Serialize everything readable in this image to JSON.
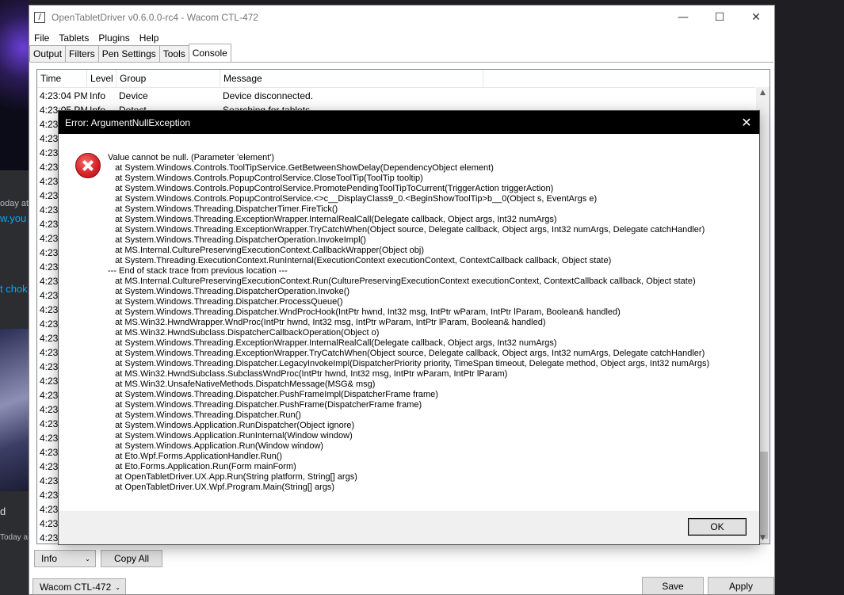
{
  "background": {
    "snippets": [
      "oday at",
      "w.you",
      "t chok",
      "d",
      "Today a"
    ]
  },
  "window": {
    "title": "OpenTabletDriver v0.6.0.0-rc4 - Wacom CTL-472",
    "app_icon": "/",
    "minimize_glyph": "—",
    "maximize_glyph": "☐",
    "close_glyph": "✕"
  },
  "menu": [
    "File",
    "Tablets",
    "Plugins",
    "Help"
  ],
  "tabs": [
    {
      "label": "Output",
      "active": false
    },
    {
      "label": "Filters",
      "active": false
    },
    {
      "label": "Pen Settings",
      "active": false
    },
    {
      "label": "Tools",
      "active": false
    },
    {
      "label": "Console",
      "active": true
    }
  ],
  "console": {
    "columns": [
      "Time",
      "Level",
      "Group",
      "Message"
    ],
    "rows": [
      {
        "time": "4:23:04 PM",
        "level": "Info",
        "group": "Device",
        "message": "Device disconnected."
      },
      {
        "time": "4:23:05 PM",
        "level": "Info",
        "group": "Detect",
        "message": "Searching for tablets..."
      },
      {
        "time": "4:23:",
        "level": "",
        "group": "",
        "message": ""
      },
      {
        "time": "4:23:",
        "level": "",
        "group": "",
        "message": ""
      },
      {
        "time": "4:23:",
        "level": "",
        "group": "",
        "message": ""
      },
      {
        "time": "4:23:",
        "level": "",
        "group": "",
        "message": ""
      },
      {
        "time": "4:23:",
        "level": "",
        "group": "",
        "message": ""
      },
      {
        "time": "4:23:",
        "level": "",
        "group": "",
        "message": ""
      },
      {
        "time": "4:23:",
        "level": "",
        "group": "",
        "message": ""
      },
      {
        "time": "4:23:",
        "level": "",
        "group": "",
        "message": ""
      },
      {
        "time": "4:23:",
        "level": "",
        "group": "",
        "message": ""
      },
      {
        "time": "4:23:",
        "level": "",
        "group": "",
        "message": ""
      },
      {
        "time": "4:23:",
        "level": "",
        "group": "",
        "message": ""
      },
      {
        "time": "4:23:",
        "level": "",
        "group": "",
        "message": ""
      },
      {
        "time": "4:23:",
        "level": "",
        "group": "",
        "message": ""
      },
      {
        "time": "4:23:",
        "level": "",
        "group": "",
        "message": ""
      },
      {
        "time": "4:23:",
        "level": "",
        "group": "",
        "message": ""
      },
      {
        "time": "4:23:",
        "level": "",
        "group": "",
        "message": ""
      },
      {
        "time": "4:23:",
        "level": "",
        "group": "",
        "message": ""
      },
      {
        "time": "4:23:",
        "level": "",
        "group": "",
        "message": ""
      },
      {
        "time": "4:23:",
        "level": "",
        "group": "",
        "message": ""
      },
      {
        "time": "4:23:",
        "level": "",
        "group": "",
        "message": ""
      },
      {
        "time": "4:23:",
        "level": "",
        "group": "",
        "message": ""
      },
      {
        "time": "4:23:",
        "level": "",
        "group": "",
        "message": ""
      },
      {
        "time": "4:23:",
        "level": "",
        "group": "",
        "message": ""
      },
      {
        "time": "4:23:",
        "level": "",
        "group": "",
        "message": ""
      },
      {
        "time": "4:23:",
        "level": "",
        "group": "",
        "message": ""
      },
      {
        "time": "4:23:",
        "level": "",
        "group": "",
        "message": ""
      },
      {
        "time": "4:23:",
        "level": "",
        "group": "",
        "message": ""
      },
      {
        "time": "4:23:",
        "level": "",
        "group": "",
        "message": ""
      },
      {
        "time": "4:23:",
        "level": "",
        "group": "",
        "message": ""
      },
      {
        "time": "4:23:",
        "level": "",
        "group": "",
        "message": ""
      }
    ],
    "level_filter": "Info",
    "copy_all_label": "Copy All"
  },
  "footer": {
    "tablet": "Wacom CTL-472",
    "save_label": "Save",
    "apply_label": "Apply"
  },
  "dialog": {
    "title": "Error: ArgumentNullException",
    "close_glyph": "✕",
    "ok_label": "OK",
    "lines": [
      "Value cannot be null. (Parameter 'element')",
      "   at System.Windows.Controls.ToolTipService.GetBetweenShowDelay(DependencyObject element)",
      "   at System.Windows.Controls.PopupControlService.CloseToolTip(ToolTip tooltip)",
      "   at System.Windows.Controls.PopupControlService.PromotePendingToolTipToCurrent(TriggerAction triggerAction)",
      "   at System.Windows.Controls.PopupControlService.<>c__DisplayClass9_0.<BeginShowToolTip>b__0(Object s, EventArgs e)",
      "   at System.Windows.Threading.DispatcherTimer.FireTick()",
      "   at System.Windows.Threading.ExceptionWrapper.InternalRealCall(Delegate callback, Object args, Int32 numArgs)",
      "   at System.Windows.Threading.ExceptionWrapper.TryCatchWhen(Object source, Delegate callback, Object args, Int32 numArgs, Delegate catchHandler)",
      "   at System.Windows.Threading.DispatcherOperation.InvokeImpl()",
      "   at MS.Internal.CulturePreservingExecutionContext.CallbackWrapper(Object obj)",
      "   at System.Threading.ExecutionContext.RunInternal(ExecutionContext executionContext, ContextCallback callback, Object state)",
      "--- End of stack trace from previous location ---",
      "   at MS.Internal.CulturePreservingExecutionContext.Run(CulturePreservingExecutionContext executionContext, ContextCallback callback, Object state)",
      "   at System.Windows.Threading.DispatcherOperation.Invoke()",
      "   at System.Windows.Threading.Dispatcher.ProcessQueue()",
      "   at System.Windows.Threading.Dispatcher.WndProcHook(IntPtr hwnd, Int32 msg, IntPtr wParam, IntPtr lParam, Boolean& handled)",
      "   at MS.Win32.HwndWrapper.WndProc(IntPtr hwnd, Int32 msg, IntPtr wParam, IntPtr lParam, Boolean& handled)",
      "   at MS.Win32.HwndSubclass.DispatcherCallbackOperation(Object o)",
      "   at System.Windows.Threading.ExceptionWrapper.InternalRealCall(Delegate callback, Object args, Int32 numArgs)",
      "   at System.Windows.Threading.ExceptionWrapper.TryCatchWhen(Object source, Delegate callback, Object args, Int32 numArgs, Delegate catchHandler)",
      "   at System.Windows.Threading.Dispatcher.LegacyInvokeImpl(DispatcherPriority priority, TimeSpan timeout, Delegate method, Object args, Int32 numArgs)",
      "   at MS.Win32.HwndSubclass.SubclassWndProc(IntPtr hwnd, Int32 msg, IntPtr wParam, IntPtr lParam)",
      "   at MS.Win32.UnsafeNativeMethods.DispatchMessage(MSG& msg)",
      "   at System.Windows.Threading.Dispatcher.PushFrameImpl(DispatcherFrame frame)",
      "   at System.Windows.Threading.Dispatcher.PushFrame(DispatcherFrame frame)",
      "   at System.Windows.Threading.Dispatcher.Run()",
      "   at System.Windows.Application.RunDispatcher(Object ignore)",
      "   at System.Windows.Application.RunInternal(Window window)",
      "   at System.Windows.Application.Run(Window window)",
      "   at Eto.Wpf.Forms.ApplicationHandler.Run()",
      "   at Eto.Forms.Application.Run(Form mainForm)",
      "   at OpenTabletDriver.UX.App.Run(String platform, String[] args)",
      "   at OpenTabletDriver.UX.Wpf.Program.Main(String[] args)"
    ]
  }
}
